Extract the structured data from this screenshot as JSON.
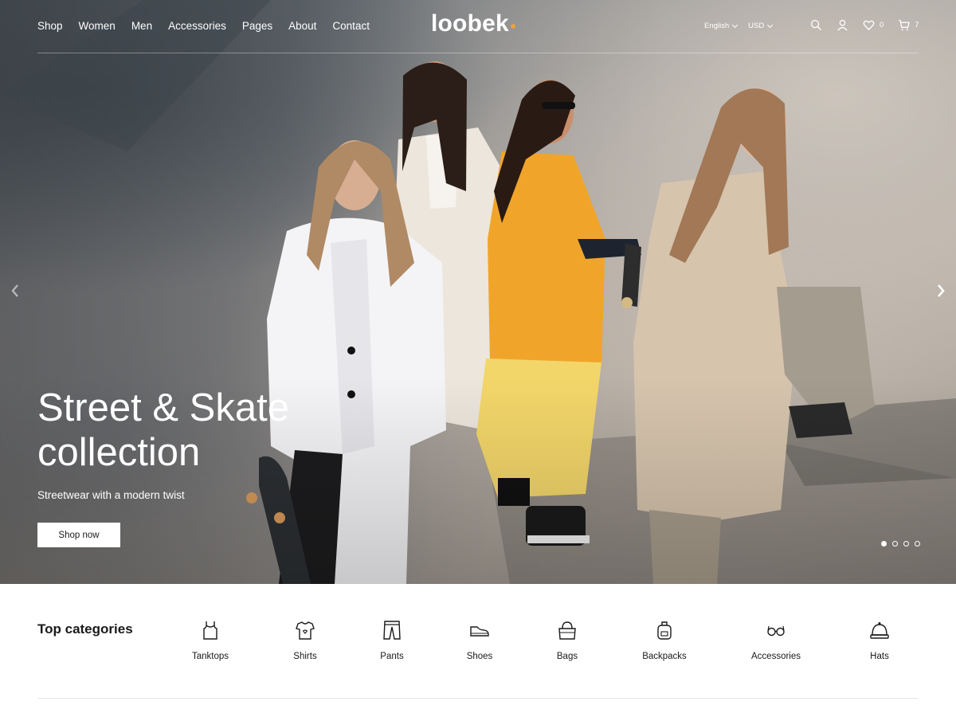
{
  "brand": {
    "logo": "loobek",
    "accent_color": "#e8a33b"
  },
  "nav": {
    "items": [
      {
        "label": "Shop"
      },
      {
        "label": "Women"
      },
      {
        "label": "Men"
      },
      {
        "label": "Accessories"
      },
      {
        "label": "Pages"
      },
      {
        "label": "About"
      },
      {
        "label": "Contact"
      }
    ]
  },
  "header": {
    "language": "English",
    "currency": "USD",
    "wishlist_count": "0",
    "cart_count": "7",
    "icons": [
      "search-icon",
      "user-icon",
      "heart-icon",
      "cart-icon"
    ]
  },
  "hero": {
    "title": "Street & Skate collection",
    "subtitle": "Streetwear with a modern twist",
    "cta_label": "Shop now",
    "slide_count": 4,
    "active_slide": 1
  },
  "categories": {
    "title": "Top categories",
    "items": [
      {
        "label": "Tanktops",
        "icon": "tanktop-icon"
      },
      {
        "label": "Shirts",
        "icon": "shirt-icon"
      },
      {
        "label": "Pants",
        "icon": "pants-icon"
      },
      {
        "label": "Shoes",
        "icon": "shoe-icon"
      },
      {
        "label": "Bags",
        "icon": "bag-icon"
      },
      {
        "label": "Backpacks",
        "icon": "backpack-icon"
      },
      {
        "label": "Accessories",
        "icon": "glasses-icon"
      },
      {
        "label": "Hats",
        "icon": "hat-icon"
      }
    ]
  }
}
